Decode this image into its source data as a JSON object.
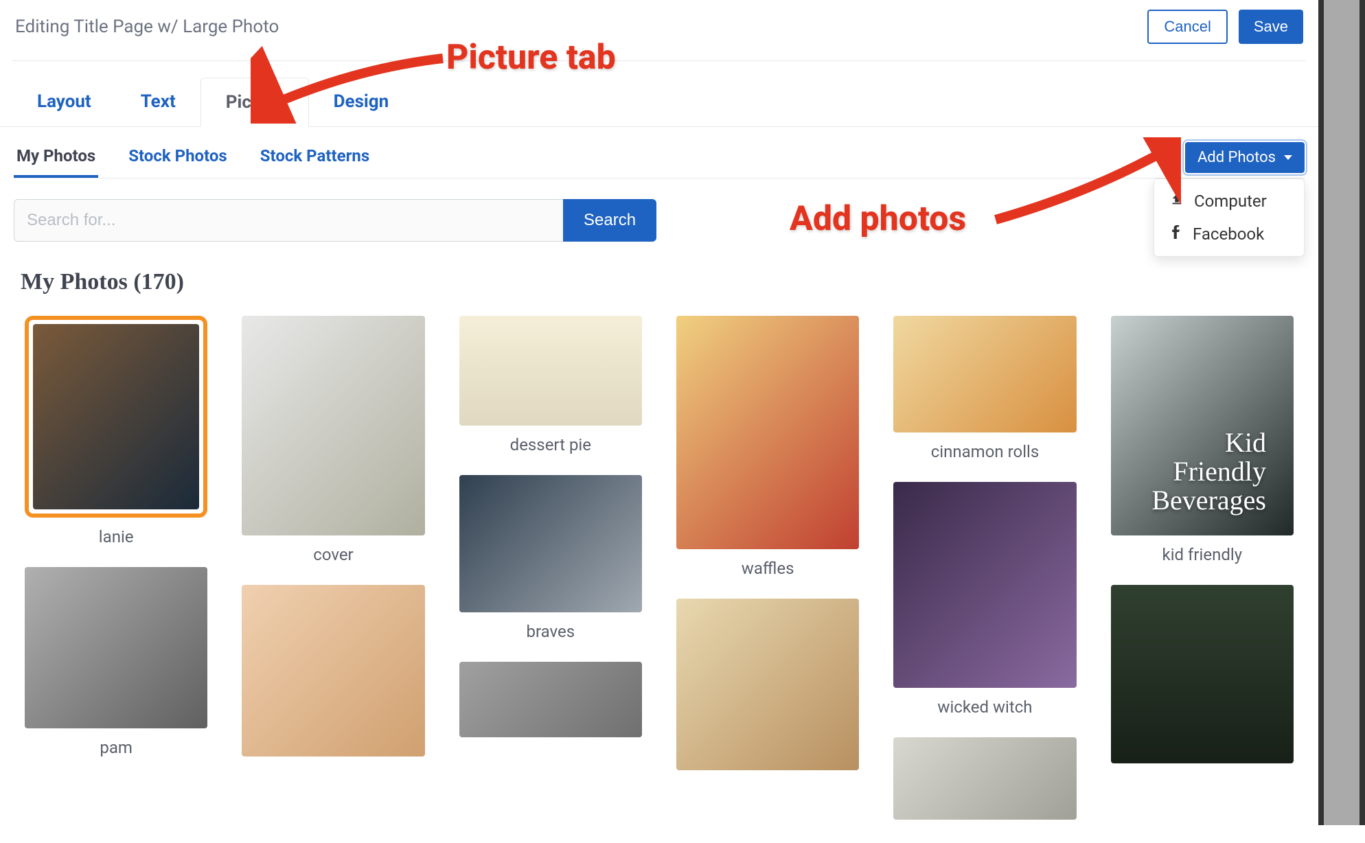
{
  "header": {
    "title": "Editing Title Page w/ Large Photo",
    "cancel_label": "Cancel",
    "save_label": "Save"
  },
  "tabs_main": {
    "layout": "Layout",
    "text": "Text",
    "picture": "Picture",
    "design": "Design",
    "active": "Picture"
  },
  "tabs_sub": {
    "my_photos": "My Photos",
    "stock_photos": "Stock Photos",
    "stock_patterns": "Stock Patterns",
    "active": "My Photos"
  },
  "add_photos": {
    "button_label": "Add Photos",
    "menu": {
      "computer": "Computer",
      "facebook": "Facebook"
    }
  },
  "search": {
    "placeholder": "Search for...",
    "button_label": "Search"
  },
  "section": {
    "title": "My Photos (170)"
  },
  "photos": {
    "col1": [
      {
        "caption": "lanie",
        "selected": true,
        "ph": "ph1"
      },
      {
        "caption": "pam",
        "selected": false,
        "ph": "ph8"
      }
    ],
    "col2": [
      {
        "caption": "cover",
        "selected": false,
        "ph": "ph2"
      },
      {
        "caption": "",
        "selected": false,
        "ph": "ph13"
      }
    ],
    "col3": [
      {
        "caption": "dessert pie",
        "selected": false,
        "ph": "ph3"
      },
      {
        "caption": "braves",
        "selected": false,
        "ph": "ph9"
      },
      {
        "caption": "",
        "selected": false,
        "ph": "ph14"
      }
    ],
    "col4": [
      {
        "caption": "waffles",
        "selected": false,
        "ph": "ph4"
      },
      {
        "caption": "",
        "selected": false,
        "ph": "ph11"
      }
    ],
    "col5": [
      {
        "caption": "cinnamon rolls",
        "selected": false,
        "ph": "ph5"
      },
      {
        "caption": "wicked witch",
        "selected": false,
        "ph": "ph10"
      },
      {
        "caption": "",
        "selected": false,
        "ph": "ph15"
      }
    ],
    "col6": [
      {
        "caption": "kid friendly",
        "selected": false,
        "ph": "ph6",
        "overlay": "Kid\nFriendly\nBeverages"
      },
      {
        "caption": "",
        "selected": false,
        "ph": "ph12"
      }
    ]
  },
  "annotations": {
    "picture_tab_label": "Picture tab",
    "add_photos_label": "Add photos"
  }
}
